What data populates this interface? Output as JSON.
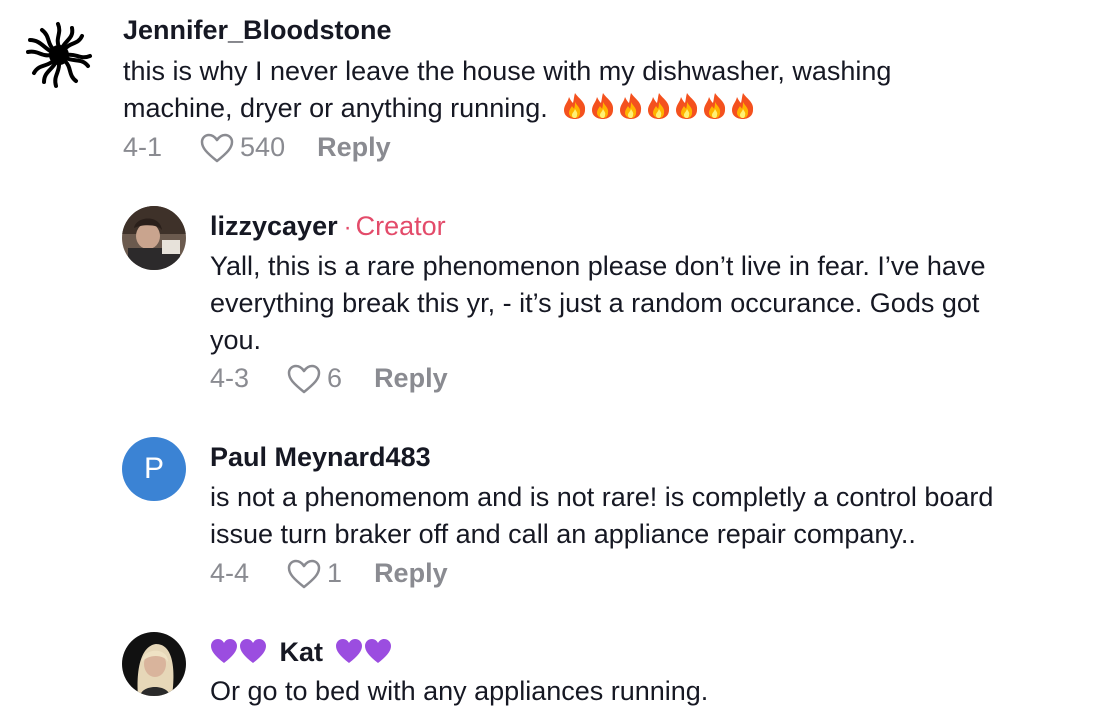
{
  "comments": [
    {
      "username": "Jennifer_Bloodstone",
      "text_line1": "this is why I never leave the house with my dishwasher, washing",
      "text_line2": "machine, dryer or anything running.",
      "emoji_count": 7,
      "emoji_name": "fire-emoji",
      "date": "4-1",
      "likes": "540",
      "reply": "Reply"
    },
    {
      "username": "lizzycayer",
      "badge_sep": "·",
      "badge": "Creator",
      "text_line1": "Yall, this is a rare phenomenon please don’t live in fear. I’ve have",
      "text_line2": "everything break this yr, - it’s just a random occurance. Gods got",
      "text_line3": "you.",
      "date": "4-3",
      "likes": "6",
      "reply": "Reply"
    },
    {
      "username": "Paul Meynard483",
      "avatar_letter": "P",
      "avatar_color": "#3b83d4",
      "text_line1": "is not a phenomenom and is not rare! is completly a control board",
      "text_line2": "issue turn braker off and call an appliance repair company..",
      "date": "4-4",
      "likes": "1",
      "reply": "Reply"
    },
    {
      "username": "Kat",
      "username_decoration": "purple-heart-emoji",
      "text_line1": "Or go to bed with any appliances running."
    }
  ],
  "colors": {
    "text": "#161823",
    "meta": "#8a8b91",
    "creator": "#e34b6a",
    "heart_purple": "#9b4de0"
  }
}
